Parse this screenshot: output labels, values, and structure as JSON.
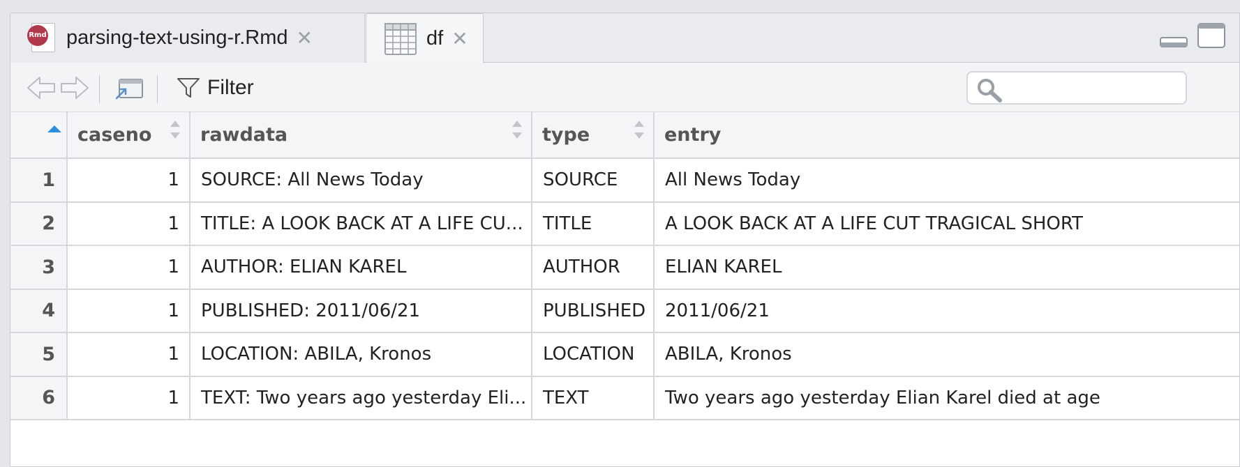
{
  "tabs": [
    {
      "label": "parsing-text-using-r.Rmd",
      "icon": "rmd-file-icon",
      "badge": "Rmd",
      "active": false
    },
    {
      "label": "df",
      "icon": "data-grid-icon",
      "active": true
    }
  ],
  "toolbar": {
    "filter_label": "Filter",
    "search": {
      "placeholder": "",
      "value": ""
    }
  },
  "table": {
    "columns": [
      "caseno",
      "rawdata",
      "type",
      "entry"
    ],
    "rows": [
      {
        "n": "1",
        "caseno": "1",
        "rawdata": "SOURCE: All News Today",
        "type": "SOURCE",
        "entry": "All News Today"
      },
      {
        "n": "2",
        "caseno": "1",
        "rawdata": "TITLE: A LOOK BACK AT A LIFE CU...",
        "type": "TITLE",
        "entry": "A LOOK BACK AT A LIFE CUT TRAGICAL SHORT"
      },
      {
        "n": "3",
        "caseno": "1",
        "rawdata": "AUTHOR: ELIAN KAREL",
        "type": "AUTHOR",
        "entry": "ELIAN KAREL"
      },
      {
        "n": "4",
        "caseno": "1",
        "rawdata": "PUBLISHED: 2011/06/21",
        "type": "PUBLISHED",
        "entry": "2011/06/21"
      },
      {
        "n": "5",
        "caseno": "1",
        "rawdata": "LOCATION: ABILA, Kronos",
        "type": "LOCATION",
        "entry": "ABILA, Kronos"
      },
      {
        "n": "6",
        "caseno": "1",
        "rawdata": "TEXT: Two years ago yesterday Eli...",
        "type": "TEXT",
        "entry": "Two years ago yesterday Elian Karel died at age"
      }
    ]
  },
  "colors": {
    "accent": "#2d8ee0",
    "header_bg": "#f4f5f6",
    "border": "#d4d7db",
    "rmd_badge": "#b03a4b"
  }
}
